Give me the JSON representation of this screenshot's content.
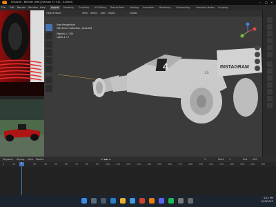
{
  "window": {
    "title": "Unsaved - Blender (edit) [Version 3? 3.0] - (Linked)"
  },
  "menu": {
    "items": [
      "File",
      "Edit",
      "Render",
      "Window",
      "Help"
    ],
    "workspaces": [
      "Layout",
      "Modeling",
      "Sculpting",
      "UV Editing",
      "Texture Paint",
      "Shading",
      "Animation",
      "Rendering",
      "Compositing",
      "Geometry Nodes",
      "Scripting"
    ],
    "active_workspace": "Layout"
  },
  "viewport": {
    "mode": "Object Mode",
    "header_items": [
      "View",
      "Select",
      "Add",
      "Object"
    ],
    "transform": "Global",
    "info_line1": "User Perspective",
    "info_line2": "(50) Scene Collection | Area.001",
    "info_objects": "Objects   1 / 100",
    "info_lights": "Lights   1 / 3",
    "car_number": "4",
    "sponsor_text": "INSTAGRAM",
    "rear_number": "16"
  },
  "timeline": {
    "header_items": [
      "Playback",
      "Keying",
      "View",
      "Marker"
    ],
    "current_frame": "1",
    "start_label": "Start",
    "start_value": "1",
    "end_label": "End",
    "end_value": "250",
    "ticks": [
      "0",
      "10",
      "20",
      "30",
      "40",
      "50",
      "60",
      "70",
      "80",
      "90",
      "100",
      "110",
      "120",
      "130",
      "140",
      "150",
      "160",
      "170",
      "180",
      "190",
      "200",
      "210",
      "220",
      "230",
      "240",
      "250"
    ]
  },
  "taskbar": {
    "time": "4:42 PM",
    "date": "1/25/2022"
  },
  "colors": {
    "accent": "#4772b3",
    "blender_orange": "#e87d0d"
  }
}
